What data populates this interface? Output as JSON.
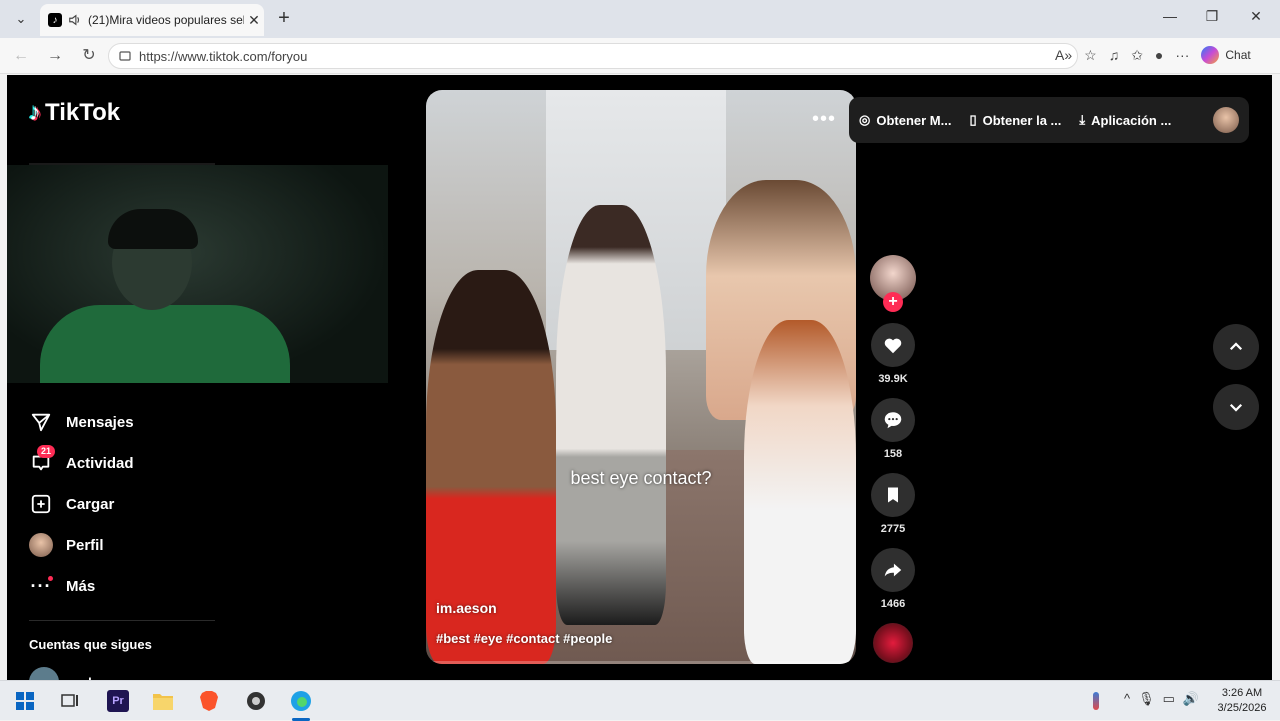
{
  "browser": {
    "tab_title": "(21)Mira videos populares sel",
    "tab_close": "✕",
    "new_tab": "+",
    "url": "https://www.tiktok.com/foryou",
    "chat_label": "Chat",
    "minimize": "—",
    "restore": "❐",
    "close": "✕"
  },
  "brand": {
    "logo_text": "TikTok"
  },
  "sidebar": {
    "items": [
      {
        "label": "Mensajes",
        "icon": "send-icon"
      },
      {
        "label": "Actividad",
        "icon": "bell-icon",
        "badge": "21"
      },
      {
        "label": "Cargar",
        "icon": "upload-icon"
      },
      {
        "label": "Perfil",
        "icon": "avatar"
      },
      {
        "label": "Más",
        "icon": "more-icon"
      }
    ],
    "following_title": "Cuentas que sigues",
    "following_user": "paloma"
  },
  "video": {
    "caption": "best eye contact?",
    "author": "im.aeson",
    "hashtags": "#best #eye #contact #people",
    "more": "•••"
  },
  "actions": {
    "likes": "39.9K",
    "comments": "158",
    "saves": "2775",
    "shares": "1466"
  },
  "topbar": {
    "coins": "Obtener M...",
    "app": "Obtener la ...",
    "desktop": "Aplicación ..."
  },
  "taskbar": {
    "time": "3:26 AM",
    "date": "3/25/2026"
  },
  "colors": {
    "accent": "#fe2c55",
    "cyan": "#25f4ee",
    "background": "#000000"
  }
}
